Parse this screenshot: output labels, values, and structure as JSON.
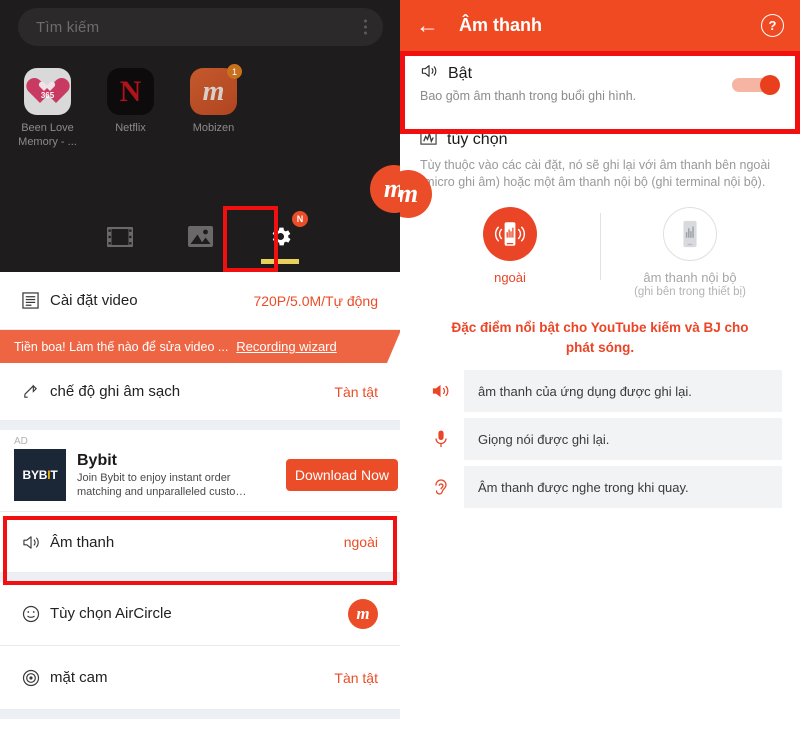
{
  "colors": {
    "accent": "#ea4d27",
    "header": "#f04a23",
    "highlight_box": "#f20f0f",
    "tab_underline": "#e8d15b",
    "dark_bg": "#1e1c1c",
    "ad_logo_bg": "#1b2637"
  },
  "left": {
    "search": {
      "placeholder": "Tìm kiếm",
      "menu_icon": "kebab-menu-icon"
    },
    "apps": [
      {
        "name": "Been Love Memory - ...",
        "icon": "been-love-memory-icon",
        "badge": "",
        "glyph": "365"
      },
      {
        "name": "Netflix",
        "icon": "netflix-icon",
        "badge": "",
        "glyph": "N"
      },
      {
        "name": "Mobizen",
        "icon": "mobizen-icon",
        "badge": "1",
        "glyph": "m"
      }
    ],
    "floating_button": {
      "label": "m",
      "icon": "mobizen-floating-icon"
    },
    "tabs": [
      {
        "icon": "film-strip-icon",
        "active": false,
        "name": "videos-tab"
      },
      {
        "icon": "image-icon",
        "active": false,
        "name": "images-tab"
      },
      {
        "icon": "gear-icon",
        "active": true,
        "badge": "N",
        "name": "settings-tab"
      }
    ],
    "rows": [
      {
        "icon": "video-settings-icon",
        "label": "Cài đặt video",
        "value": "720P/5.0M/Tự động"
      },
      {
        "icon": "clean-recording-icon",
        "label": "chế độ ghi âm sạch",
        "value": "Tàn tật"
      },
      {
        "icon": "sound-icon",
        "label": "Âm thanh",
        "value": "ngoài"
      },
      {
        "icon": "aircircle-icon",
        "label": "Tùy chọn AirCircle",
        "value": ""
      },
      {
        "icon": "face-cam-icon",
        "label": "mặt cam",
        "value": "Tàn tật"
      }
    ],
    "promo": {
      "text": "Tiền boa! Làm thế nào để sửa video ...",
      "cta": "Recording wizard"
    },
    "ad": {
      "tag": "AD",
      "logo_text_main": "BYB",
      "logo_text_accent": "I",
      "logo_text_tail": "T",
      "title": "Bybit",
      "description": "Join Bybit to enjoy instant order matching and unparalleled custo…",
      "button": "Download Now"
    }
  },
  "right": {
    "header": {
      "back_icon": "back-arrow-icon",
      "title": "Âm thanh",
      "help_icon": "help-icon",
      "help_glyph": "?"
    },
    "toggle": {
      "icon": "speaker-icon",
      "title": "Bật",
      "subtitle": "Bao gồm âm thanh trong buổi ghi hình.",
      "state": "on"
    },
    "options": {
      "icon": "audio-wave-icon",
      "title": "tùy chọn",
      "description": "Tùy thuộc vào các cài đặt, nó sẽ ghi lại với âm thanh bên ngoài (micro ghi âm) hoặc một âm thanh nội bộ (ghi terminal nội bộ)."
    },
    "modes": [
      {
        "icon": "external-mic-icon",
        "label": "ngoài",
        "sublabel": "",
        "selected": true
      },
      {
        "icon": "internal-audio-icon",
        "label": "âm thanh nội bộ",
        "sublabel": "(ghi bên trong thiết bị)",
        "selected": false
      }
    ],
    "feature_note": "Đặc điểm nổi bật cho YouTube kiếm và BJ cho phát sóng.",
    "facts": [
      {
        "icon": "speaker-loud-icon",
        "text": "âm thanh của ứng dụng được ghi lại."
      },
      {
        "icon": "microphone-icon",
        "text": "Giọng nói được ghi lại."
      },
      {
        "icon": "ear-icon",
        "text": "Âm thanh được nghe trong khi quay."
      }
    ],
    "floating_button": {
      "label": "m",
      "icon": "mobizen-floating-icon"
    }
  }
}
